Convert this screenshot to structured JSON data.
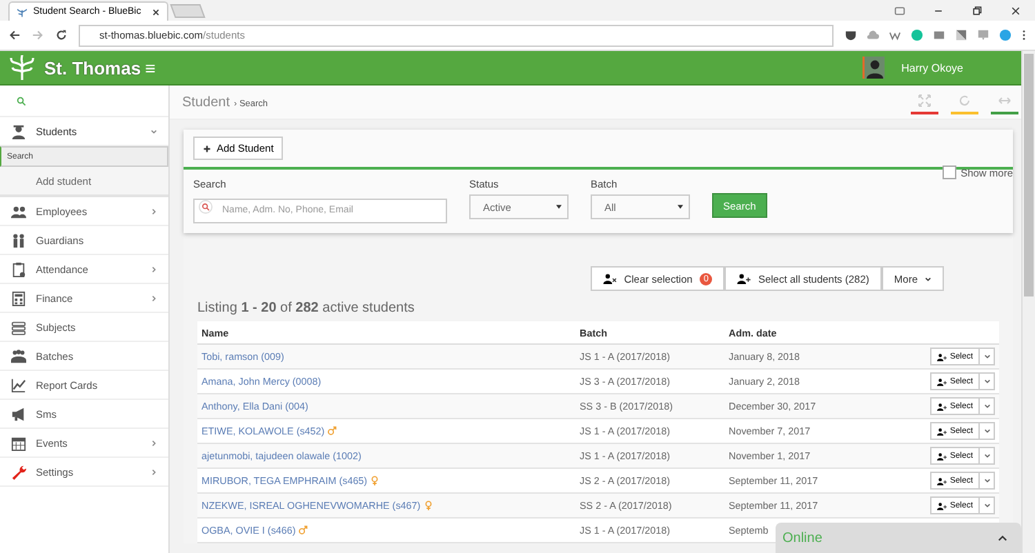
{
  "browser": {
    "tab_title": "Student Search - BlueBic",
    "url_host": "st-thomas.bluebic.com",
    "url_path": "/students"
  },
  "header": {
    "brand": "St. Thomas",
    "menu_glyph": "≡",
    "user_name": "Harry Okoye"
  },
  "sidebar": {
    "items": [
      {
        "label": "Students",
        "kind": "student",
        "expandable": true,
        "expanded": true,
        "children": [
          {
            "label": "Search",
            "selected": true
          },
          {
            "label": "Add student",
            "selected": false
          }
        ]
      },
      {
        "label": "Employees",
        "kind": "people",
        "expandable": true,
        "expanded": false
      },
      {
        "label": "Guardians",
        "kind": "family",
        "expandable": false,
        "expanded": false
      },
      {
        "label": "Attendance",
        "kind": "clipboard",
        "expandable": true,
        "expanded": false
      },
      {
        "label": "Finance",
        "kind": "calc",
        "expandable": true,
        "expanded": false
      },
      {
        "label": "Subjects",
        "kind": "books",
        "expandable": false,
        "expanded": false
      },
      {
        "label": "Batches",
        "kind": "group",
        "expandable": false,
        "expanded": false
      },
      {
        "label": "Report Cards",
        "kind": "chart",
        "expandable": false,
        "expanded": false
      },
      {
        "label": "Sms",
        "kind": "megaphone",
        "expandable": false,
        "expanded": false
      },
      {
        "label": "Events",
        "kind": "calendar",
        "expandable": true,
        "expanded": false
      },
      {
        "label": "Settings",
        "kind": "wrench",
        "expandable": true,
        "expanded": false
      }
    ]
  },
  "breadcrumb": {
    "title": "Student",
    "separator": "›",
    "current": "Search"
  },
  "toolbar": {
    "add_button": "Add Student"
  },
  "filters": {
    "search_label": "Search",
    "search_placeholder": "Name, Adm. No, Phone, Email",
    "status_label": "Status",
    "status_value": "Active",
    "batch_label": "Batch",
    "batch_value": "All",
    "search_button": "Search",
    "show_more_label": "Show more",
    "show_more_checked": false
  },
  "actions": {
    "clear_selection": "Clear selection",
    "selection_count": "0",
    "select_all": "Select all students (282)",
    "more": "More"
  },
  "listing": "Listing **1 - 20** of **282** active students",
  "table": {
    "columns": [
      "Name",
      "Batch",
      "Adm. date"
    ],
    "rows": [
      {
        "name": "Tobi, ramson (009)",
        "kind": "plain",
        "batch": "JS 1 - A (2017/2018)",
        "adm_date": "January 8, 2018",
        "action": "Select"
      },
      {
        "name": "Amana, John Mercy (0008)",
        "kind": "plain",
        "batch": "JS 3 - A (2017/2018)",
        "adm_date": "January 2, 2018",
        "action": "Select"
      },
      {
        "name": "Anthony, Ella Dani (004)",
        "kind": "plain",
        "batch": "SS 3 - B (2017/2018)",
        "adm_date": "December 30, 2017",
        "action": "Select"
      },
      {
        "name": "ETIWE, KOLAWOLE (s452)",
        "kind": "male",
        "batch": "JS 1 - A (2017/2018)",
        "adm_date": "November 7, 2017",
        "action": "Select"
      },
      {
        "name": "ajetunmobi, tajudeen olawale (1002)",
        "kind": "plain",
        "batch": "JS 1 - A (2017/2018)",
        "adm_date": "November 1, 2017",
        "action": "Select"
      },
      {
        "name": "MIRUBOR, TEGA EMPHRAIM (s465)",
        "kind": "female",
        "batch": "JS 2 - A (2017/2018)",
        "adm_date": "September 11, 2017",
        "action": "Select"
      },
      {
        "name": "NZEKWE, ISREAL OGHENEVWOMARHE (s467)",
        "kind": "female",
        "batch": "SS 2 - A (2017/2018)",
        "adm_date": "September 11, 2017",
        "action": "Select"
      },
      {
        "name": "OGBA, OVIE I (s466)",
        "kind": "male",
        "batch": "JS 1 - A (2017/2018)",
        "adm_date": "Septemb"
      }
    ]
  },
  "chat": {
    "status": "Online"
  }
}
